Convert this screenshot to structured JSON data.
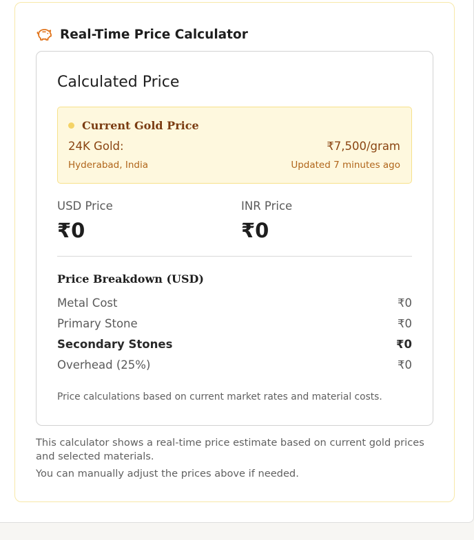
{
  "calculator": {
    "title": "Real-Time Price Calculator",
    "title_icon": "piggy-bank-icon",
    "accent": "#e0731a"
  },
  "result": {
    "heading": "Calculated Price",
    "gold": {
      "label": "Current Gold Price",
      "metal": "24K Gold:",
      "price": "₹7,500/gram",
      "location": "Hyderabad, India",
      "updated": "Updated 7 minutes ago"
    },
    "usd": {
      "label": "USD Price",
      "value": "₹0"
    },
    "inr": {
      "label": "INR Price",
      "value": "₹0"
    },
    "breakdown": {
      "title": "Price Breakdown (USD)",
      "rows": [
        {
          "label": "Metal Cost",
          "value": "₹0"
        },
        {
          "label": "Primary Stone",
          "value": "₹0"
        },
        {
          "label": "Secondary Stones",
          "value": "₹0"
        },
        {
          "label": "Overhead (25%)",
          "value": "₹0"
        }
      ]
    },
    "footnote": "Price calculations based on current market rates and material costs."
  },
  "help": {
    "line1": "This calculator shows a real-time price estimate based on current gold prices and selected materials.",
    "line2": "You can manually adjust the prices above if needed."
  }
}
